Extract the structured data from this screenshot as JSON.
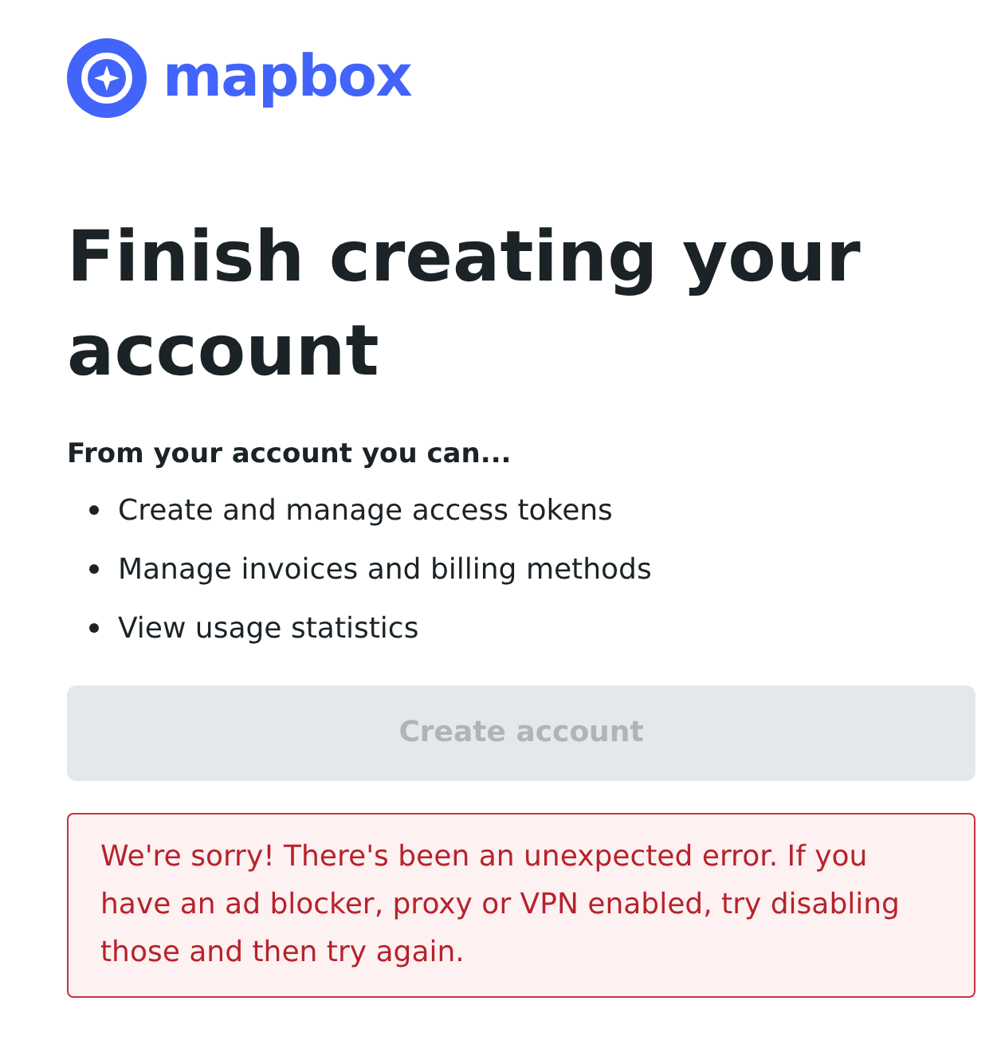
{
  "logo": {
    "text": "mapbox"
  },
  "heading": "Finish creating your account",
  "intro": "From your account you can...",
  "features": [
    "Create and manage access tokens",
    "Manage invoices and billing methods",
    "View usage statistics"
  ],
  "create_button": {
    "label": "Create account",
    "disabled": true
  },
  "error_message": "We're sorry! There's been an unexpected error. If you have an ad blocker, proxy or VPN enabled, try disabling those and then try again."
}
